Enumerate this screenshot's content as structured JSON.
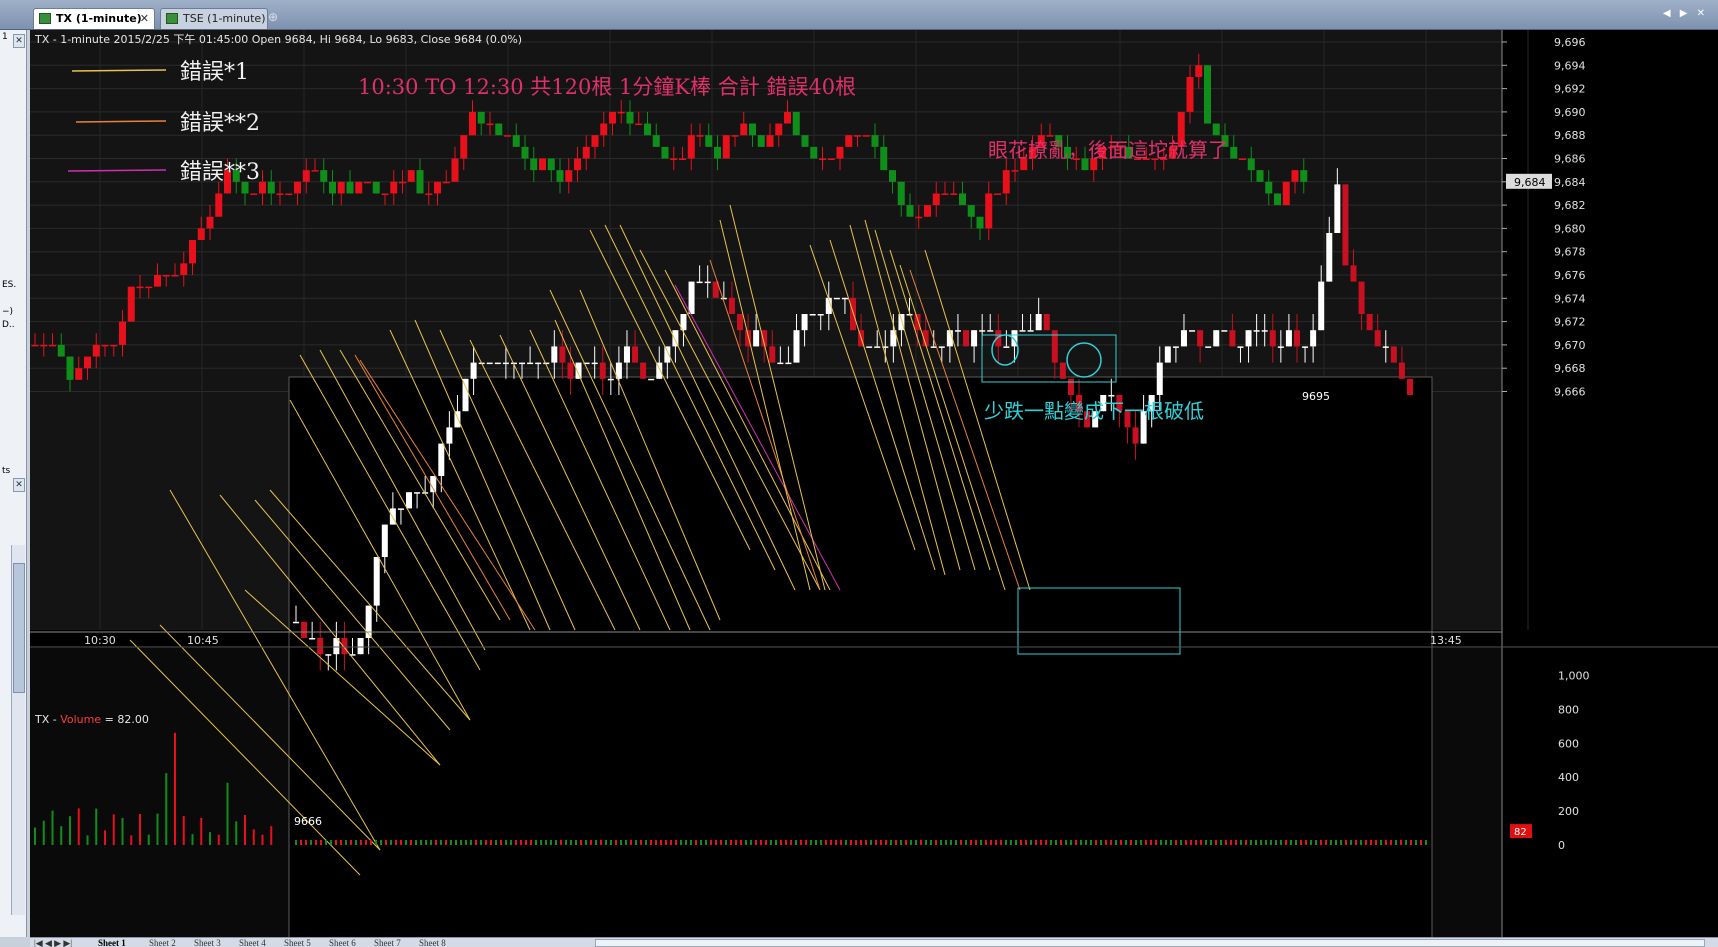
{
  "tabs": [
    {
      "label": "TX (1-minute)",
      "close": "✕"
    },
    {
      "label": "TSE (1-minute)"
    }
  ],
  "tab_add": "⊕",
  "tab_nav": "◀ ▶ ✕",
  "left_panel": {
    "texts": [
      "1",
      "✕",
      "ES.",
      "−)",
      "D..",
      "ts",
      "✕"
    ]
  },
  "chart_header": "TX - 1-minute 2015/2/25 下午 01:45:00 Open 9684, Hi 9684, Lo 9683, Close 9684 (0.0%)",
  "volume_header": {
    "prefix": "TX - ",
    "name": "Volume",
    "suffix": " = 82.00"
  },
  "legend": [
    {
      "label": "錯誤*1",
      "color": "#e8c24a"
    },
    {
      "label": "錯誤**2",
      "color": "#e8823a"
    },
    {
      "label": "錯誤**3",
      "color": "#d030b0"
    }
  ],
  "annotations": {
    "title": "10:30 TO 12:30 共120根 1分鐘K棒 合計 錯誤40根",
    "blur": "眼花撩亂，後面這坨就算了",
    "missed": "少跌一點變成下一根破低",
    "low_label": "9666",
    "high_label": "9695"
  },
  "colors": {
    "up": "#e8101a",
    "down": "#0f8f1a",
    "overlay_up": "#ffffff",
    "overlay_down": "#c81020",
    "accent_text": "#e0306a",
    "cyan": "#30d0d8"
  },
  "price_axis": {
    "labels": [
      "9,696",
      "9,694",
      "9,692",
      "9,690",
      "9,688",
      "9,686",
      "9,684",
      "9,682",
      "9,680",
      "9,678",
      "9,676",
      "9,674",
      "9,672",
      "9,670",
      "9,668",
      "9,666"
    ],
    "current": "9,684"
  },
  "time_axis": {
    "labels": [
      "10:30",
      "10:45",
      "13:45"
    ]
  },
  "volume_axis": {
    "labels": [
      "1,000",
      "800",
      "600",
      "400",
      "200",
      "0"
    ],
    "current": "82"
  },
  "sheets": [
    "Sheet 1",
    "Sheet 2",
    "Sheet 3",
    "Sheet 4",
    "Sheet 5",
    "Sheet 6",
    "Sheet 7",
    "Sheet 8"
  ],
  "chart_data": {
    "type": "candlestick",
    "symbol": "TX",
    "interval": "1-minute",
    "ylim": [
      9665,
      9697
    ],
    "last": {
      "open": 9684,
      "high": 9684,
      "low": 9683,
      "close": 9684
    },
    "volume_last": 82,
    "main_closes": [
      9670,
      9670,
      9670,
      9669,
      9667,
      9668,
      9669,
      9670,
      9670,
      9670,
      9672,
      9675,
      9675,
      9675,
      9676,
      9676,
      9676,
      9677,
      9679,
      9680,
      9681,
      9683,
      9685,
      9684,
      9683,
      9683,
      9684,
      9683,
      9683,
      9683,
      9684,
      9685,
      9685,
      9684,
      9683,
      9684,
      9683,
      9684,
      9684,
      9683,
      9683,
      9684,
      9684,
      9685,
      9683,
      9683,
      9684,
      9684,
      9686,
      9688,
      9690,
      9689,
      9689,
      9688,
      9688,
      9687,
      9686,
      9685,
      9686,
      9685,
      9684,
      9685,
      9686,
      9687,
      9688,
      9689,
      9690,
      9690,
      9689,
      9689,
      9688,
      9687,
      9686,
      9686,
      9686,
      9688,
      9688,
      9687,
      9686,
      9688,
      9688,
      9689,
      9688,
      9687,
      9688,
      9689,
      9690,
      9688,
      9687,
      9686,
      9686,
      9686,
      9687,
      9688,
      9688,
      9688,
      9687,
      9685,
      9684,
      9682,
      9681,
      9681,
      9682,
      9683,
      9683,
      9683,
      9682,
      9681,
      9680,
      9683,
      9683,
      9685,
      9685,
      9686,
      9687,
      9688,
      9688,
      9687,
      9686,
      9686,
      9685,
      9686,
      9687,
      9687,
      9687,
      9686,
      9686,
      9686,
      9686,
      9686,
      9687,
      9690,
      9693,
      9694,
      9689,
      9688,
      9687,
      9686,
      9686,
      9685,
      9684,
      9683,
      9682,
      9684,
      9685,
      9684
    ],
    "overlay_closes": [
      9668,
      9667,
      9667,
      9666,
      9666,
      9667,
      9666,
      9666,
      9667,
      9669,
      9672,
      9674,
      9675,
      9675,
      9676,
      9676,
      9676,
      9677,
      9679,
      9680,
      9681,
      9683,
      9684,
      9684,
      9684,
      9684,
      9684,
      9684,
      9684,
      9684,
      9684,
      9684,
      9685,
      9684,
      9683,
      9684,
      9684,
      9684,
      9683,
      9683,
      9684,
      9685,
      9684,
      9683,
      9683,
      9684,
      9685,
      9686,
      9687,
      9689,
      9689,
      9689,
      9688,
      9688,
      9687,
      9686,
      9685,
      9686,
      9685,
      9684,
      9684,
      9684,
      9686,
      9687,
      9687,
      9687,
      9688,
      9688,
      9688,
      9686,
      9685,
      9685,
      9685,
      9685,
      9686,
      9687,
      9687,
      9686,
      9685,
      9685,
      9685,
      9686,
      9686,
      9685,
      9686,
      9686,
      9686,
      9685,
      9685,
      9686,
      9686,
      9686,
      9687,
      9686,
      9684,
      9683,
      9682,
      9681,
      9680,
      9681,
      9682,
      9682,
      9681,
      9680,
      9679,
      9681,
      9682,
      9684,
      9685,
      9685,
      9686,
      9686,
      9685,
      9685,
      9686,
      9686,
      9685,
      9685,
      9686,
      9686,
      9686,
      9685,
      9685,
      9686,
      9685,
      9685,
      9686,
      9689,
      9692,
      9695,
      9690,
      9689,
      9687,
      9686,
      9685,
      9685,
      9684,
      9683,
      9682
    ]
  }
}
